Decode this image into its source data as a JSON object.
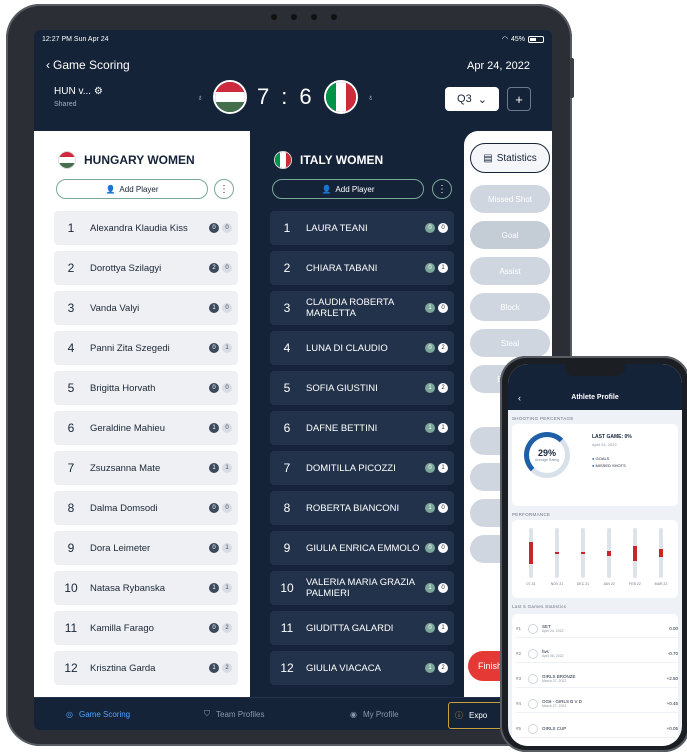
{
  "status": {
    "time": "12:27 PM  Sun Apr 24",
    "battery": "45%"
  },
  "header": {
    "back_label": "Game Scoring",
    "date": "Apr 24, 2022",
    "game_name": "HUN v...",
    "shared": "Shared",
    "score_home": "7",
    "score_sep": ":",
    "score_away": "6",
    "quarter": "Q3",
    "plus": "+"
  },
  "home": {
    "team": "HUNGARY WOMEN",
    "add_player": "Add Player",
    "players": [
      {
        "num": "1",
        "name": "Alexandra Klaudia Kiss",
        "a": "0",
        "b": "0"
      },
      {
        "num": "2",
        "name": "Dorottya Szilagyi",
        "a": "2",
        "b": "0"
      },
      {
        "num": "3",
        "name": "Vanda Valyi",
        "a": "1",
        "b": "0"
      },
      {
        "num": "4",
        "name": "Panni Zita Szegedi",
        "a": "0",
        "b": "1"
      },
      {
        "num": "5",
        "name": "Brigitta Horvath",
        "a": "0",
        "b": "0"
      },
      {
        "num": "6",
        "name": "Geraldine Mahieu",
        "a": "1",
        "b": "0"
      },
      {
        "num": "7",
        "name": "Zsuzsanna Mate",
        "a": "1",
        "b": "1"
      },
      {
        "num": "8",
        "name": "Dalma Domsodi",
        "a": "0",
        "b": "0"
      },
      {
        "num": "9",
        "name": "Dora Leimeter",
        "a": "0",
        "b": "1"
      },
      {
        "num": "10",
        "name": "Natasa Rybanska",
        "a": "1",
        "b": "1"
      },
      {
        "num": "11",
        "name": "Kamilla Farago",
        "a": "0",
        "b": "2"
      },
      {
        "num": "12",
        "name": "Krisztina Garda",
        "a": "1",
        "b": "2"
      }
    ]
  },
  "away": {
    "team": "ITALY WOMEN",
    "add_player": "Add Player",
    "players": [
      {
        "num": "1",
        "name": "LAURA TEANI",
        "a": "0",
        "b": "0"
      },
      {
        "num": "2",
        "name": "CHIARA TABANI",
        "a": "0",
        "b": "1"
      },
      {
        "num": "3",
        "name": "CLAUDIA ROBERTA MARLETTA",
        "a": "1",
        "b": "0"
      },
      {
        "num": "4",
        "name": "LUNA DI CLAUDIO",
        "a": "0",
        "b": "2"
      },
      {
        "num": "5",
        "name": "SOFIA GIUSTINI",
        "a": "1",
        "b": "2"
      },
      {
        "num": "6",
        "name": "DAFNE BETTINI",
        "a": "1",
        "b": "1"
      },
      {
        "num": "7",
        "name": "DOMITILLA PICOZZI",
        "a": "0",
        "b": "1"
      },
      {
        "num": "8",
        "name": "ROBERTA BIANCONI",
        "a": "1",
        "b": "0"
      },
      {
        "num": "9",
        "name": "GIULIA ENRICA EMMOLO",
        "a": "0",
        "b": "0"
      },
      {
        "num": "10",
        "name": "VALERIA MARIA GRAZIA PALMIERI",
        "a": "1",
        "b": "0"
      },
      {
        "num": "11",
        "name": "GIUDITTA GALARDI",
        "a": "0",
        "b": "1"
      },
      {
        "num": "12",
        "name": "GIULIA VIACACA",
        "a": "1",
        "b": "2"
      }
    ]
  },
  "actions": {
    "statistics": "Statistics",
    "missed_shot": "Missed Shot",
    "goal": "Goal",
    "assist": "Assist",
    "block": "Block",
    "steal": "Steal",
    "earned": "Earned",
    "finish": "Finish"
  },
  "tabs": {
    "game_scoring": "Game Scoring",
    "team_profiles": "Team Profiles",
    "my_profile": "My Profile",
    "export": "Expo",
    "export_sub": "V"
  },
  "phone": {
    "title": "Athlete Profile",
    "shooting_label": "SHOOTING PERCENTAGE",
    "pct": "29%",
    "pct_sub": "Average Rating",
    "last_game": "LAST GAME: 0%",
    "last_game_date": "April 24, 2022",
    "legend_goals": "GOALS",
    "legend_missed": "MISSED SHOTS",
    "performance_label": "PERFORMANCE",
    "perf_labels": [
      "07-31",
      "NOV 21",
      "DEC 21",
      "JAN 22",
      "FEB 22",
      "MAR 22"
    ],
    "perf_values": [
      0.45,
      0.0,
      0.0,
      0.1,
      0.3,
      0.15
    ],
    "last5_label": "Last 5 Games Statistics",
    "games": [
      {
        "n": "#1",
        "t": "SET",
        "date": "April 24, 2022",
        "d": "0.00"
      },
      {
        "n": "#2",
        "t": "fws",
        "date": "April 08, 2022",
        "d": "-0.70"
      },
      {
        "n": "#3",
        "t": "GIRLS BRONZE",
        "date": "March 27, 2022",
        "d": "+2.50"
      },
      {
        "n": "#4",
        "t": "OG6 - GIRLS B V D",
        "date": "March 27, 2022",
        "d": "+0.45"
      },
      {
        "n": "#5",
        "t": "GIRLS CUP",
        "date": "",
        "d": "+0.05"
      }
    ]
  }
}
